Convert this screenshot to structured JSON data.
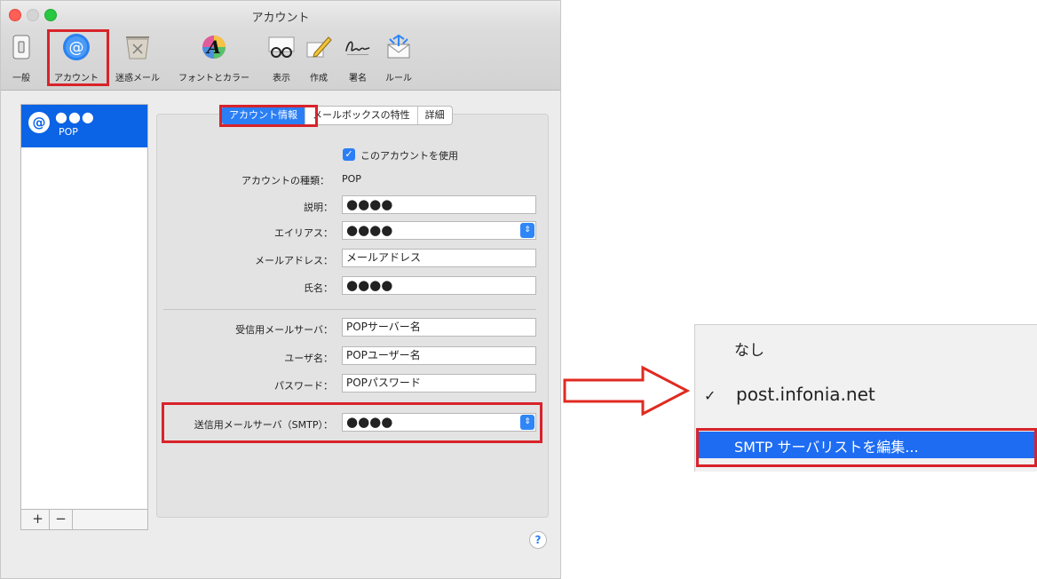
{
  "window": {
    "title": "アカウント"
  },
  "toolbar": {
    "items": [
      {
        "label": "一般",
        "icon": "switch-icon"
      },
      {
        "label": "アカウント",
        "icon": "at-icon"
      },
      {
        "label": "迷惑メール",
        "icon": "trash-icon"
      },
      {
        "label": "フォントとカラー",
        "icon": "font-color-icon"
      },
      {
        "label": "表示",
        "icon": "glasses-icon"
      },
      {
        "label": "作成",
        "icon": "pencil-icon"
      },
      {
        "label": "署名",
        "icon": "signature-icon"
      },
      {
        "label": "ルール",
        "icon": "rules-envelope-icon"
      }
    ]
  },
  "sidebar": {
    "account": {
      "name": "●●●",
      "type": "POP",
      "icon": "at-icon"
    },
    "add_label": "+",
    "remove_label": "−"
  },
  "tabs": [
    {
      "label": "アカウント情報",
      "active": true
    },
    {
      "label": "メールボックスの特性",
      "active": false
    },
    {
      "label": "詳細",
      "active": false
    }
  ],
  "form": {
    "use_account_label": "このアカウントを使用",
    "use_account_checked": true,
    "account_type_label": "アカウントの種類：",
    "account_type_value": "POP",
    "description_label": "説明：",
    "description_value": "●●●●",
    "alias_label": "エイリアス：",
    "alias_value": "●●●●",
    "email_label": "メールアドレス：",
    "email_value": "メールアドレス",
    "name_label": "氏名：",
    "name_value": "●●●●",
    "incoming_server_label": "受信用メールサーバ：",
    "incoming_server_value": "POPサーバー名",
    "username_label": "ユーザ名：",
    "username_value": "POPユーザー名",
    "password_label": "パスワード：",
    "password_value": "POPパスワード",
    "smtp_label": "送信用メールサーバ（SMTP）：",
    "smtp_value": "●●●●"
  },
  "help_label": "?",
  "smtp_menu": {
    "items": [
      {
        "label": "なし",
        "checked": false
      },
      {
        "label": "post.infonia.net",
        "checked": true
      },
      {
        "label": "SMTP サーバリストを編集...",
        "highlighted": true
      }
    ],
    "check_mark": "✓"
  },
  "colors": {
    "highlight": "#d8232a",
    "selection_blue": "#0b63e5"
  }
}
